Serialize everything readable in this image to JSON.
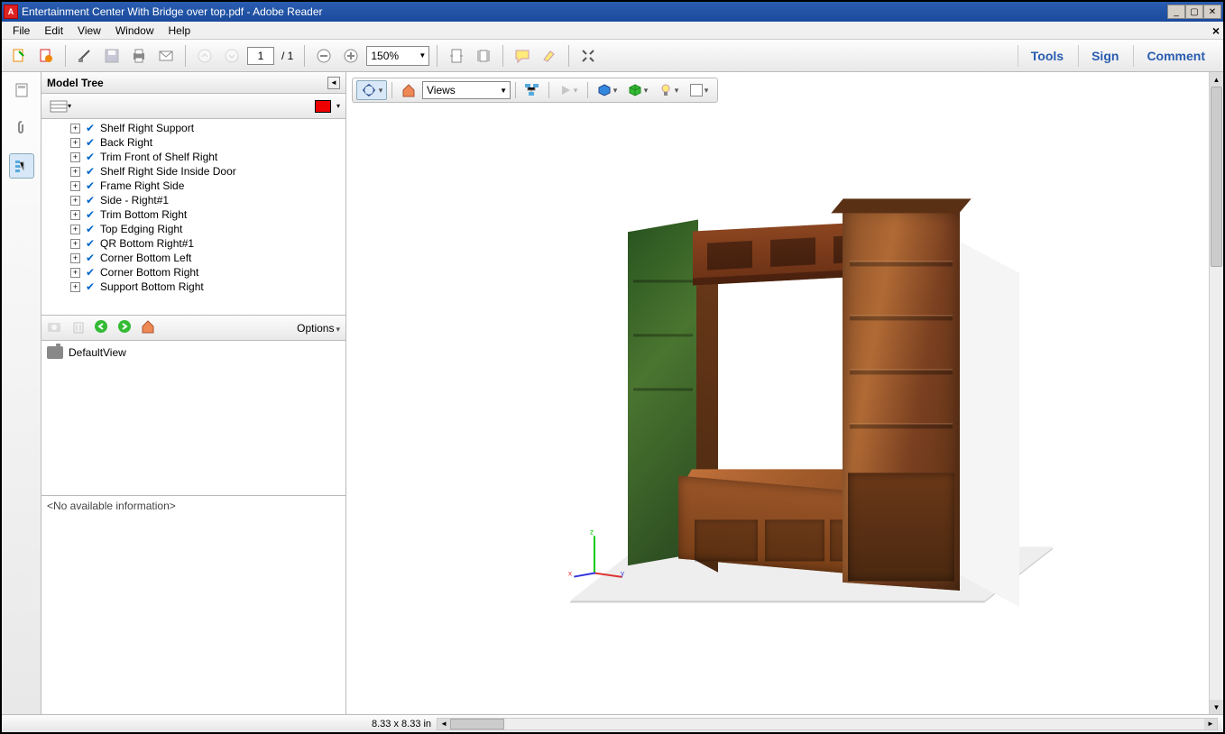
{
  "titlebar": {
    "title": "Entertainment Center With Bridge over top.pdf - Adobe Reader"
  },
  "menu": {
    "items": [
      "File",
      "Edit",
      "View",
      "Window",
      "Help"
    ]
  },
  "toolbar": {
    "page_current": "1",
    "page_total": "/ 1",
    "zoom": "150%"
  },
  "right_links": [
    "Tools",
    "Sign",
    "Comment"
  ],
  "panel": {
    "title": "Model Tree",
    "tree_items": [
      "Shelf Right Support",
      "Back Right",
      "Trim Front of Shelf Right",
      "Shelf Right Side Inside Door",
      "Frame Right Side",
      "Side - Right#1",
      "Trim Bottom Right",
      "Top Edging Right",
      "QR Bottom Right#1",
      "Corner Bottom Left",
      "Corner Bottom Right",
      "Support Bottom Right"
    ],
    "views_options_label": "Options",
    "default_view": "DefaultView",
    "info": "<No available information>"
  },
  "v3d": {
    "views_label": "Views"
  },
  "status": {
    "dims": "8.33 x 8.33 in"
  }
}
